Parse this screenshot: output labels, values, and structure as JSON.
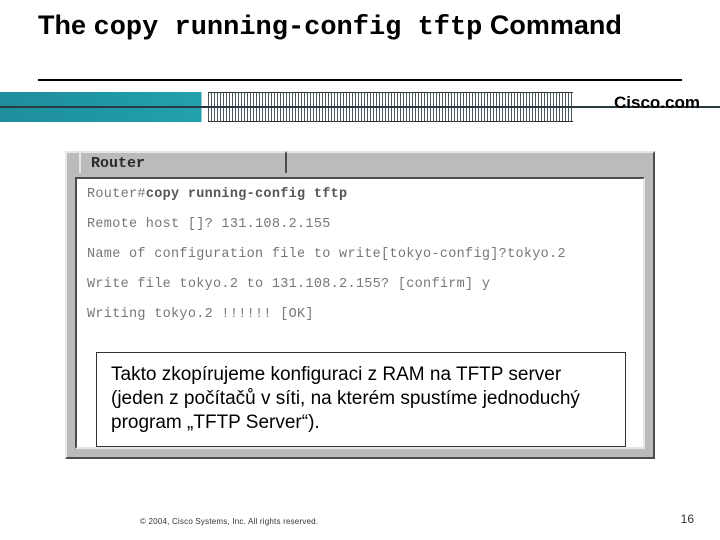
{
  "title": {
    "pre": "The ",
    "code": "copy running-config tftp",
    "post": " Command"
  },
  "logo": {
    "text": "Cisco.com"
  },
  "terminal": {
    "tab": "Router",
    "lines": {
      "l0_prompt": "Router#",
      "l0_cmd": "copy running-config tftp",
      "l1": "Remote host []? 131.108.2.155",
      "l2": "Name of configuration file to write[tokyo-config]?tokyo.2",
      "l3": "Write file tokyo.2 to 131.108.2.155? [confirm] y",
      "l4": "Writing tokyo.2 !!!!!! [OK]"
    }
  },
  "caption": "Takto zkopírujeme konfiguraci z RAM na TFTP server (jeden z počítačů v síti, na kterém spustíme jednoduchý program „TFTP Server“).",
  "footer": {
    "copyright": "© 2004, Cisco Systems, Inc. All rights reserved.",
    "slide_number": "16"
  }
}
